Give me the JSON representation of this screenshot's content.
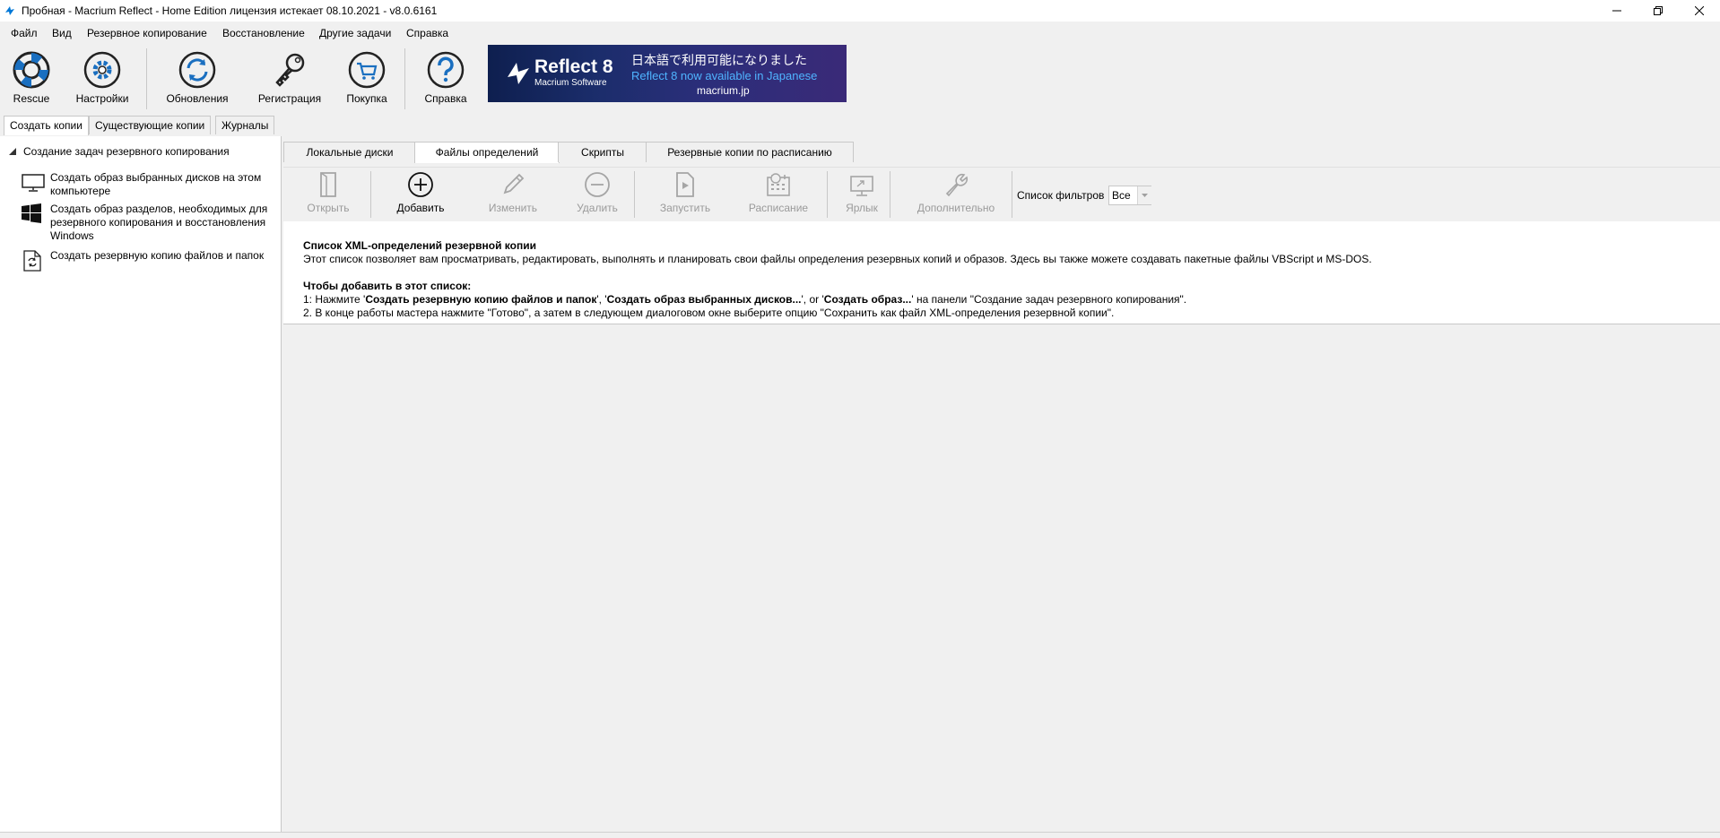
{
  "window": {
    "title": "Пробная - Macrium Reflect - Home Edition лицензия истекает 08.10.2021 - v8.0.6161"
  },
  "menu": [
    "Файл",
    "Вид",
    "Резервное копирование",
    "Восстановление",
    "Другие задачи",
    "Справка"
  ],
  "toolbar": {
    "rescue": "Rescue",
    "settings": "Настройки",
    "updates": "Обновления",
    "registration": "Регистрация",
    "purchase": "Покупка",
    "help": "Справка"
  },
  "banner": {
    "product": "Reflect 8",
    "company": "Macrium Software",
    "line_jp": "日本語で利用可能になりました",
    "line_en": "Reflect 8 now available in Japanese",
    "url": "macrium.jp"
  },
  "left_tabs": [
    "Создать копии",
    "Существующие копии",
    "Журналы"
  ],
  "tasks": {
    "header": "Создание задач резервного копирования",
    "items": [
      "Создать образ выбранных дисков на этом компьютере",
      "Создать образ разделов, необходимых для резервного копирования и восстановления Windows",
      "Создать резервную копию файлов и папок"
    ]
  },
  "right_tabs": [
    "Локальные диски",
    "Файлы определений",
    "Скрипты",
    "Резервные копии по расписанию"
  ],
  "actions": {
    "open": "Открыть",
    "add": "Добавить",
    "edit": "Изменить",
    "delete": "Удалить",
    "run": "Запустить",
    "schedule": "Расписание",
    "shortcut": "Ярлык",
    "advanced": "Дополнительно",
    "filter_label": "Список фильтров",
    "filter_value": "Все"
  },
  "description": {
    "heading": "Список XML-определений резервной копии",
    "text": "Этот список позволяет вам просматривать, редактировать, выполнять и планировать свои файлы определения резервных копий и образов. Здесь вы также можете создавать пакетные файлы VBScript и MS-DOS.",
    "howto_heading": "Чтобы добавить в этот список:",
    "step1_prefix": "1: Нажмите '",
    "step1_b1": "Создать резервную копию файлов и папок",
    "step1_sep1": "', '",
    "step1_b2": "Создать образ выбранных дисков...",
    "step1_sep2": "', or '",
    "step1_b3": "Создать образ...",
    "step1_suffix": "' на панели \"Создание задач резервного копирования\".",
    "step2": "2. В конце работы мастера нажмите \"Готово\", а затем в следующем диалоговом окне выберите опцию \"Сохранить как файл XML-определения резервной копии\"."
  },
  "colors": {
    "accent": "#0078d7",
    "disabled": "#9a9a9a",
    "banner_bg": "#1b2d6b",
    "banner_en": "#4fb4ff"
  }
}
